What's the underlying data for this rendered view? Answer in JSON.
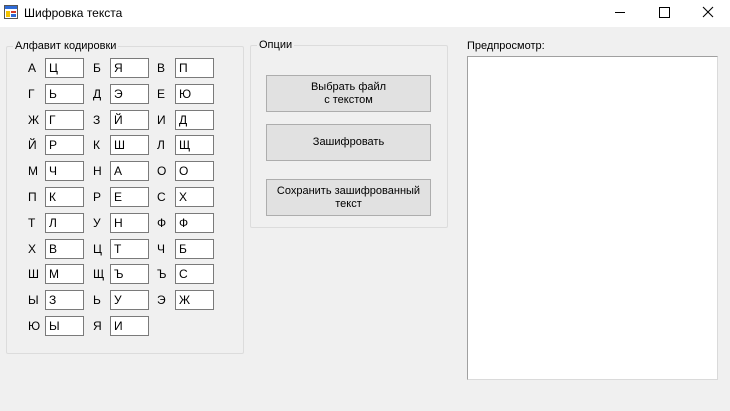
{
  "window": {
    "title": "Шифровка текста"
  },
  "alphabet_group": {
    "title": "Алфавит кодировки",
    "rows": [
      [
        {
          "letter": "А",
          "code": "Ц"
        },
        {
          "letter": "Б",
          "code": "Я"
        },
        {
          "letter": "В",
          "code": "П"
        }
      ],
      [
        {
          "letter": "Г",
          "code": "Ь"
        },
        {
          "letter": "Д",
          "code": "Э"
        },
        {
          "letter": "Е",
          "code": "Ю"
        }
      ],
      [
        {
          "letter": "Ж",
          "code": "Г"
        },
        {
          "letter": "З",
          "code": "Й"
        },
        {
          "letter": "И",
          "code": "Д"
        }
      ],
      [
        {
          "letter": "Й",
          "code": "Р"
        },
        {
          "letter": "К",
          "code": "Ш"
        },
        {
          "letter": "Л",
          "code": "Щ"
        }
      ],
      [
        {
          "letter": "М",
          "code": "Ч"
        },
        {
          "letter": "Н",
          "code": "А"
        },
        {
          "letter": "О",
          "code": "О"
        }
      ],
      [
        {
          "letter": "П",
          "code": "К"
        },
        {
          "letter": "Р",
          "code": "Е"
        },
        {
          "letter": "С",
          "code": "Х"
        }
      ],
      [
        {
          "letter": "Т",
          "code": "Л"
        },
        {
          "letter": "У",
          "code": "Н"
        },
        {
          "letter": "Ф",
          "code": "Ф"
        }
      ],
      [
        {
          "letter": "Х",
          "code": "В"
        },
        {
          "letter": "Ц",
          "code": "Т"
        },
        {
          "letter": "Ч",
          "code": "Б"
        }
      ],
      [
        {
          "letter": "Ш",
          "code": "М"
        },
        {
          "letter": "Щ",
          "code": "Ъ"
        },
        {
          "letter": "Ъ",
          "code": "С"
        }
      ],
      [
        {
          "letter": "Ы",
          "code": "З"
        },
        {
          "letter": "Ь",
          "code": "У"
        },
        {
          "letter": "Э",
          "code": "Ж"
        }
      ],
      [
        {
          "letter": "Ю",
          "code": "Ы"
        },
        {
          "letter": "Я",
          "code": "И"
        }
      ]
    ]
  },
  "options_group": {
    "title": "Опции",
    "choose_file_label": "Выбрать файл\nс текстом",
    "encrypt_label": "Зашифровать",
    "save_label": "Сохранить зашифрованный\nтекст"
  },
  "preview": {
    "label": "Предпросмотр:",
    "content": ""
  },
  "colors": {
    "window_background": "#f0f0f0",
    "button_face": "#e1e1e1",
    "icon_yellow": "#f5c400",
    "icon_blue": "#2f6bd6",
    "icon_red": "#d23a2a"
  },
  "icons": {
    "app": "app-window-icon",
    "minimize": "minimize-icon",
    "maximize": "maximize-icon",
    "close": "close-icon"
  }
}
